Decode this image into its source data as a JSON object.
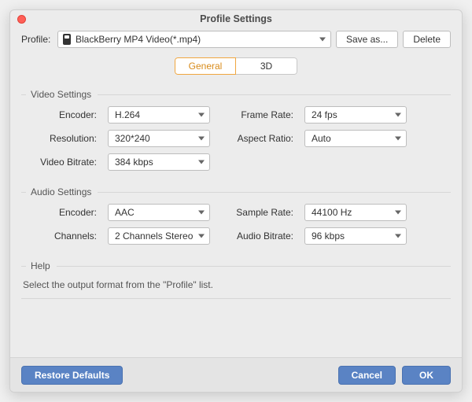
{
  "title": "Profile Settings",
  "profile": {
    "label": "Profile:",
    "selected": "BlackBerry MP4 Video(*.mp4)",
    "saveAs": "Save as...",
    "delete": "Delete"
  },
  "tabs": {
    "general": "General",
    "threeD": "3D"
  },
  "video": {
    "heading": "Video Settings",
    "encoderLabel": "Encoder:",
    "encoder": "H.264",
    "frameRateLabel": "Frame Rate:",
    "frameRate": "24 fps",
    "resolutionLabel": "Resolution:",
    "resolution": "320*240",
    "aspectLabel": "Aspect Ratio:",
    "aspect": "Auto",
    "bitrateLabel": "Video Bitrate:",
    "bitrate": "384 kbps"
  },
  "audio": {
    "heading": "Audio Settings",
    "encoderLabel": "Encoder:",
    "encoder": "AAC",
    "sampleRateLabel": "Sample Rate:",
    "sampleRate": "44100 Hz",
    "channelsLabel": "Channels:",
    "channels": "2 Channels Stereo",
    "bitrateLabel": "Audio Bitrate:",
    "bitrate": "96 kbps"
  },
  "help": {
    "heading": "Help",
    "text": "Select the output format from the \"Profile\" list."
  },
  "footer": {
    "restore": "Restore Defaults",
    "cancel": "Cancel",
    "ok": "OK"
  }
}
